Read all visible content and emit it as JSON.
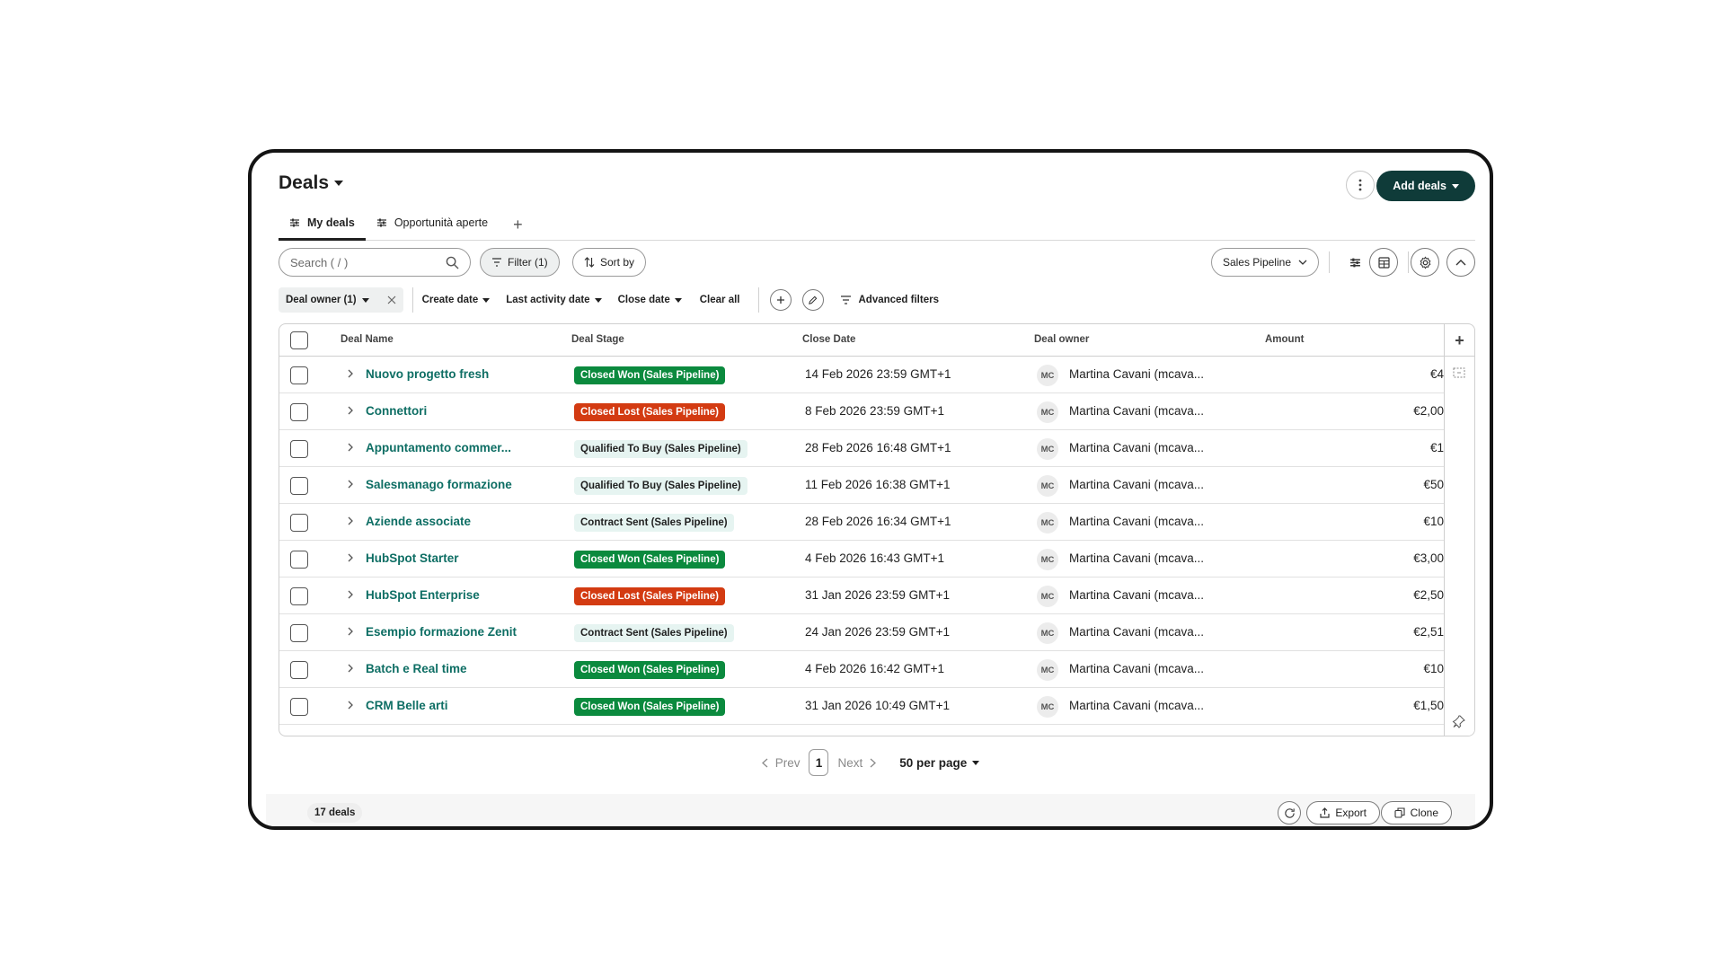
{
  "header": {
    "title": "Deals",
    "more_icon": "vertical-dots-icon",
    "add_label": "Add deals"
  },
  "tabs": [
    {
      "label": "My deals",
      "active": true,
      "icon": "view-sliders-icon"
    },
    {
      "label": "Opportunità aperte",
      "active": false,
      "icon": "view-sliders-icon"
    }
  ],
  "toolbar": {
    "search_placeholder": "Search ( / )",
    "filter_label": "Filter (1)",
    "sort_label": "Sort by",
    "pipeline_label": "Sales Pipeline"
  },
  "filters": {
    "owner_chip": "Deal owner (1)",
    "dropdowns": [
      "Create date",
      "Last activity date",
      "Close date"
    ],
    "clear_label": "Clear all",
    "advanced_label": "Advanced filters"
  },
  "table": {
    "columns": [
      "Deal Name",
      "Deal Stage",
      "Close Date",
      "Deal owner",
      "Amount"
    ],
    "rows": [
      {
        "name": "Nuovo progetto fresh",
        "stage": "Closed Won (Sales Pipeline)",
        "stage_type": "won",
        "close": "14 Feb 2026 23:59 GMT+1",
        "initials": "MC",
        "owner": "Martina Cavani (mcava...",
        "amount": "€4"
      },
      {
        "name": "Connettori",
        "stage": "Closed Lost (Sales Pipeline)",
        "stage_type": "lost",
        "close": "8 Feb 2026 23:59 GMT+1",
        "initials": "MC",
        "owner": "Martina Cavani (mcava...",
        "amount": "€2,00"
      },
      {
        "name": "Appuntamento commer...",
        "stage": "Qualified To Buy (Sales Pipeline)",
        "stage_type": "qual",
        "close": "28 Feb 2026 16:48 GMT+1",
        "initials": "MC",
        "owner": "Martina Cavani (mcava...",
        "amount": "€1"
      },
      {
        "name": "Salesmanago formazione",
        "stage": "Qualified To Buy (Sales Pipeline)",
        "stage_type": "qual",
        "close": "11 Feb 2026 16:38 GMT+1",
        "initials": "MC",
        "owner": "Martina Cavani (mcava...",
        "amount": "€50"
      },
      {
        "name": "Aziende associate",
        "stage": "Contract Sent (Sales Pipeline)",
        "stage_type": "contract",
        "close": "28 Feb 2026 16:34 GMT+1",
        "initials": "MC",
        "owner": "Martina Cavani (mcava...",
        "amount": "€10"
      },
      {
        "name": "HubSpot Starter",
        "stage": "Closed Won (Sales Pipeline)",
        "stage_type": "won",
        "close": "4 Feb 2026 16:43 GMT+1",
        "initials": "MC",
        "owner": "Martina Cavani (mcava...",
        "amount": "€3,00"
      },
      {
        "name": "HubSpot Enterprise",
        "stage": "Closed Lost (Sales Pipeline)",
        "stage_type": "lost",
        "close": "31 Jan 2026 23:59 GMT+1",
        "initials": "MC",
        "owner": "Martina Cavani (mcava...",
        "amount": "€2,50"
      },
      {
        "name": "Esempio formazione Zenit",
        "stage": "Contract Sent (Sales Pipeline)",
        "stage_type": "contract",
        "close": "24 Jan 2026 23:59 GMT+1",
        "initials": "MC",
        "owner": "Martina Cavani (mcava...",
        "amount": "€2,51"
      },
      {
        "name": "Batch e Real time",
        "stage": "Closed Won (Sales Pipeline)",
        "stage_type": "won",
        "close": "4 Feb 2026 16:42 GMT+1",
        "initials": "MC",
        "owner": "Martina Cavani (mcava...",
        "amount": "€10"
      },
      {
        "name": "CRM Belle arti",
        "stage": "Closed Won (Sales Pipeline)",
        "stage_type": "won",
        "close": "31 Jan 2026 10:49 GMT+1",
        "initials": "MC",
        "owner": "Martina Cavani (mcava...",
        "amount": "€1,50"
      }
    ]
  },
  "pagination": {
    "prev_label": "Prev",
    "page": "1",
    "next_label": "Next",
    "per_page_label": "50 per page"
  },
  "footer": {
    "count_label": "17 deals",
    "export_label": "Export",
    "clone_label": "Clone"
  },
  "colors": {
    "primary": "#0f3b39",
    "link": "#0e6e64",
    "won": "#0b8a3e",
    "lost": "#d33b12",
    "neutral_stage": "#e6f4f1"
  }
}
